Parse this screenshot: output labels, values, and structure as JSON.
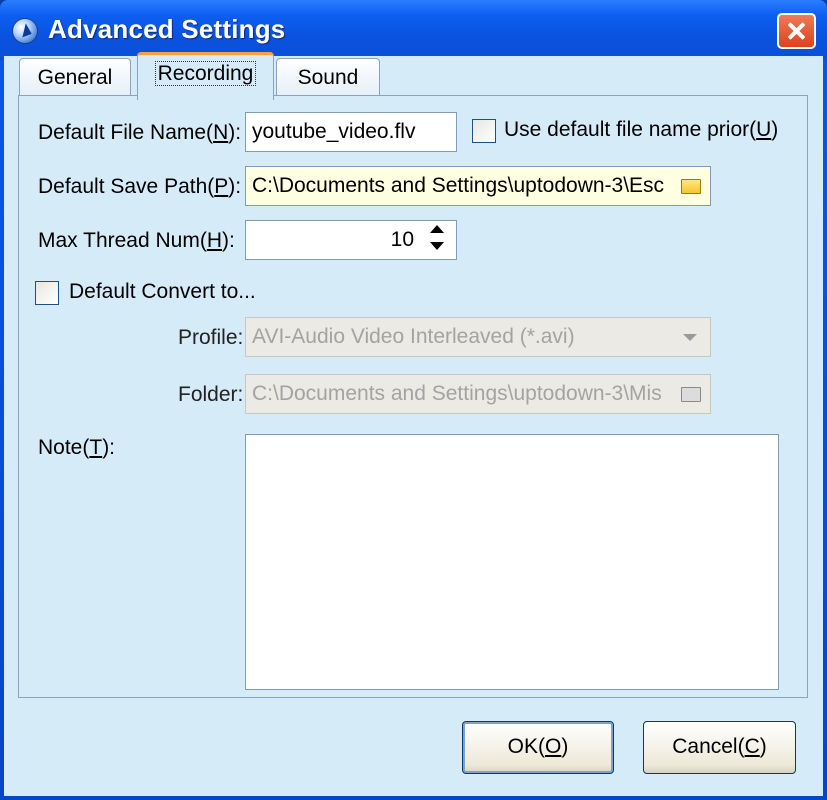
{
  "window": {
    "title": "Advanced Settings"
  },
  "tabs": [
    {
      "label": "General",
      "active": false
    },
    {
      "label": "Recording",
      "active": true
    },
    {
      "label": "Sound",
      "active": false
    }
  ],
  "fields": {
    "file_name": {
      "label_pre": "Default File Name(",
      "label_key": "N",
      "label_post": "):",
      "value": "youtube_video.flv"
    },
    "use_default_prior": {
      "label_pre": "Use default file name prior(",
      "label_key": "U",
      "label_post": ")",
      "checked": false
    },
    "save_path": {
      "label_pre": "Default Save Path(",
      "label_key": "P",
      "label_post": "):",
      "value": "C:\\Documents and Settings\\uptodown-3\\Esc"
    },
    "max_thread": {
      "label_pre": "Max Thread Num(",
      "label_key": "H",
      "label_post": "):",
      "value": "10"
    },
    "default_convert": {
      "label": "Default Convert to...",
      "checked": false
    },
    "profile": {
      "label": "Profile:",
      "value": "AVI-Audio Video Interleaved (*.avi)"
    },
    "folder": {
      "label": "Folder:",
      "value": "C:\\Documents and Settings\\uptodown-3\\Mis"
    },
    "note": {
      "label_pre": "Note(",
      "label_key": "T",
      "label_post": "):",
      "value": ""
    }
  },
  "buttons": {
    "ok": {
      "pre": "OK(",
      "key": "O",
      "post": ")"
    },
    "cancel": {
      "pre": "Cancel(",
      "key": "C",
      "post": ")"
    }
  },
  "icons": {
    "app": "app-logo-icon",
    "close": "close-icon",
    "browse": "folder-icon",
    "spin": "spinner-arrows-icon",
    "dropdown": "chevron-down-icon"
  },
  "colors": {
    "titlebar": "#0a52e0",
    "dialog_bg": "#d6ebf8",
    "active_tab_accent": "#ff9f3a",
    "close_button": "#d9441c",
    "path_field_bg": "#ffffe1"
  }
}
